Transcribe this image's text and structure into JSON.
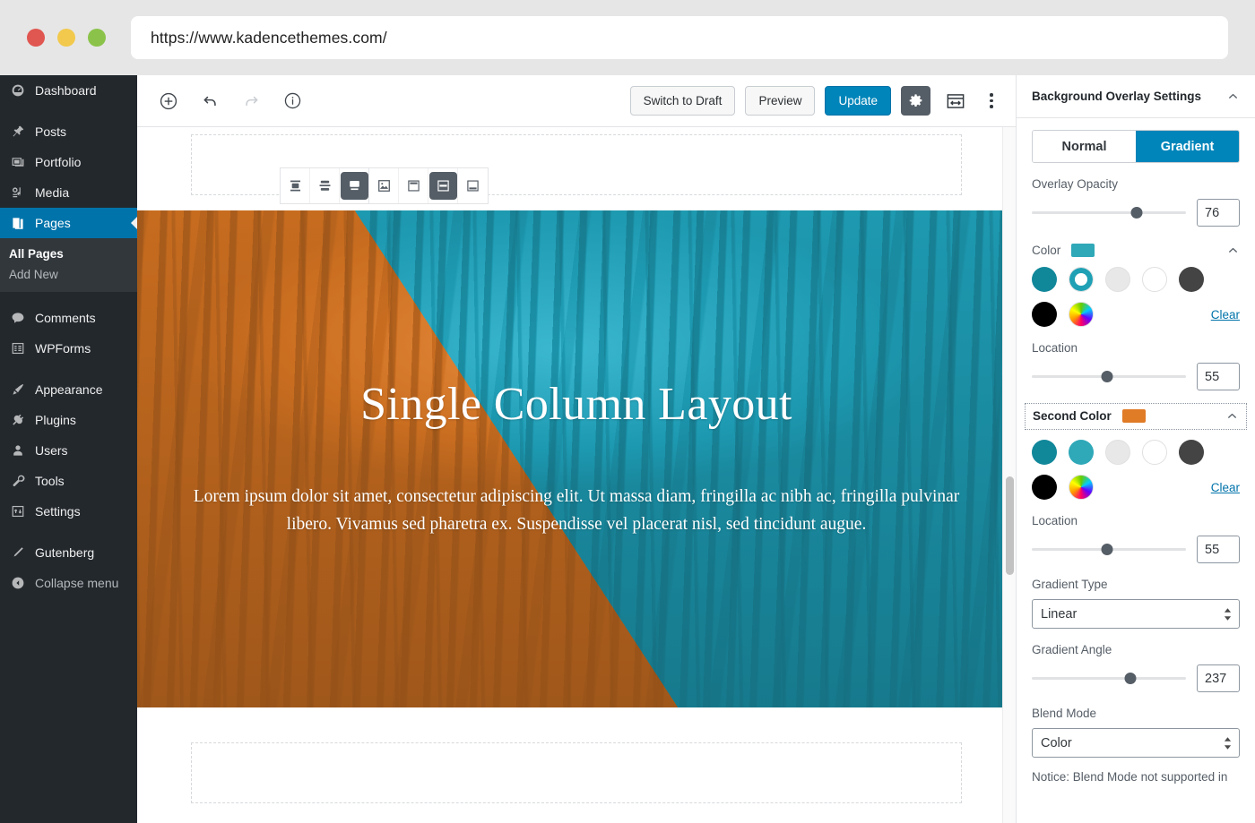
{
  "browser": {
    "url": "https://www.kadencethemes.com/",
    "traffic_lights": [
      "close-red",
      "minimize-yellow",
      "maximize-green"
    ]
  },
  "sidebar": {
    "items": [
      {
        "label": "Dashboard",
        "icon": "dashboard-icon",
        "active": false
      },
      {
        "label": "Posts",
        "icon": "pin-icon",
        "active": false
      },
      {
        "label": "Portfolio",
        "icon": "portfolio-icon",
        "active": false
      },
      {
        "label": "Media",
        "icon": "media-icon",
        "active": false
      },
      {
        "label": "Pages",
        "icon": "pages-icon",
        "active": true
      },
      {
        "label": "Comments",
        "icon": "comments-icon",
        "active": false
      },
      {
        "label": "WPForms",
        "icon": "wpforms-icon",
        "active": false
      },
      {
        "label": "Appearance",
        "icon": "appearance-icon",
        "active": false
      },
      {
        "label": "Plugins",
        "icon": "plugins-icon",
        "active": false
      },
      {
        "label": "Users",
        "icon": "users-icon",
        "active": false
      },
      {
        "label": "Tools",
        "icon": "tools-icon",
        "active": false
      },
      {
        "label": "Settings",
        "icon": "settings-icon",
        "active": false
      },
      {
        "label": "Gutenberg",
        "icon": "gutenberg-icon",
        "active": false
      },
      {
        "label": "Collapse menu",
        "icon": "collapse-icon",
        "active": false
      }
    ],
    "submenu": {
      "all_pages": "All Pages",
      "add_new": "Add New"
    },
    "accent_color": "#0073aa",
    "background_color": "#23282d"
  },
  "editor_header": {
    "add_block_icon": "plus-circle-icon",
    "undo_icon": "undo-icon",
    "redo_icon": "redo-icon",
    "info_icon": "info-circle-icon",
    "switch_to_draft": "Switch to Draft",
    "preview": "Preview",
    "update": "Update",
    "settings_gear_icon": "gear-icon",
    "block_navigation_icon": "sidebar-toggle-icon",
    "more_menu_icon": "kebab-menu-icon"
  },
  "block_toolbar": {
    "buttons": [
      {
        "name": "align-top-icon",
        "active": false
      },
      {
        "name": "align-middle-icon",
        "active": false
      },
      {
        "name": "align-bottom-icon",
        "active": true
      },
      {
        "name": "image-icon",
        "active": false
      },
      {
        "name": "content-top-icon",
        "active": false
      },
      {
        "name": "content-middle-icon",
        "active": true
      },
      {
        "name": "content-bottom-icon",
        "active": false
      }
    ]
  },
  "hero": {
    "title": "Single Column Layout",
    "paragraph": "Lorem ipsum dolor sit amet, consectetur adipiscing elit. Ut massa diam, fringilla ac nibh ac, fringilla pulvinar libero. Vivamus sed pharetra ex. Suspendisse vel placerat nisl, sed tincidunt augue.",
    "overlay_first_color": "#1fa9c4",
    "overlay_second_color": "#e07b26",
    "overlay_angle": 237
  },
  "settings_panel": {
    "title": "Background Overlay Settings",
    "tabs": {
      "normal": "Normal",
      "gradient": "Gradient",
      "selected": "Gradient"
    },
    "overlay_opacity": {
      "label": "Overlay Opacity",
      "value": "76",
      "percent": 63
    },
    "color": {
      "label": "Color",
      "swatch": "#2fa8b8",
      "selected_index": 1,
      "clear": "Clear",
      "swatches": [
        "#11879a",
        "#1fa0b4",
        "#e8e8e8",
        "#ffffff",
        "#444444",
        "#000000",
        "rainbow"
      ]
    },
    "location_first": {
      "label": "Location",
      "value": "55",
      "percent": 49
    },
    "second_color": {
      "label": "Second Color",
      "swatch": "#e07b26",
      "clear": "Clear",
      "swatches": [
        "#11879a",
        "#2fa8b8",
        "#e8e8e8",
        "#ffffff",
        "#444444",
        "#000000",
        "rainbow"
      ]
    },
    "location_second": {
      "label": "Location",
      "value": "55",
      "percent": 49
    },
    "gradient_type": {
      "label": "Gradient Type",
      "value": "Linear"
    },
    "gradient_angle": {
      "label": "Gradient Angle",
      "value": "237",
      "percent": 54
    },
    "blend_mode": {
      "label": "Blend Mode",
      "value": "Color"
    },
    "notice": "Notice: Blend Mode not supported in"
  }
}
